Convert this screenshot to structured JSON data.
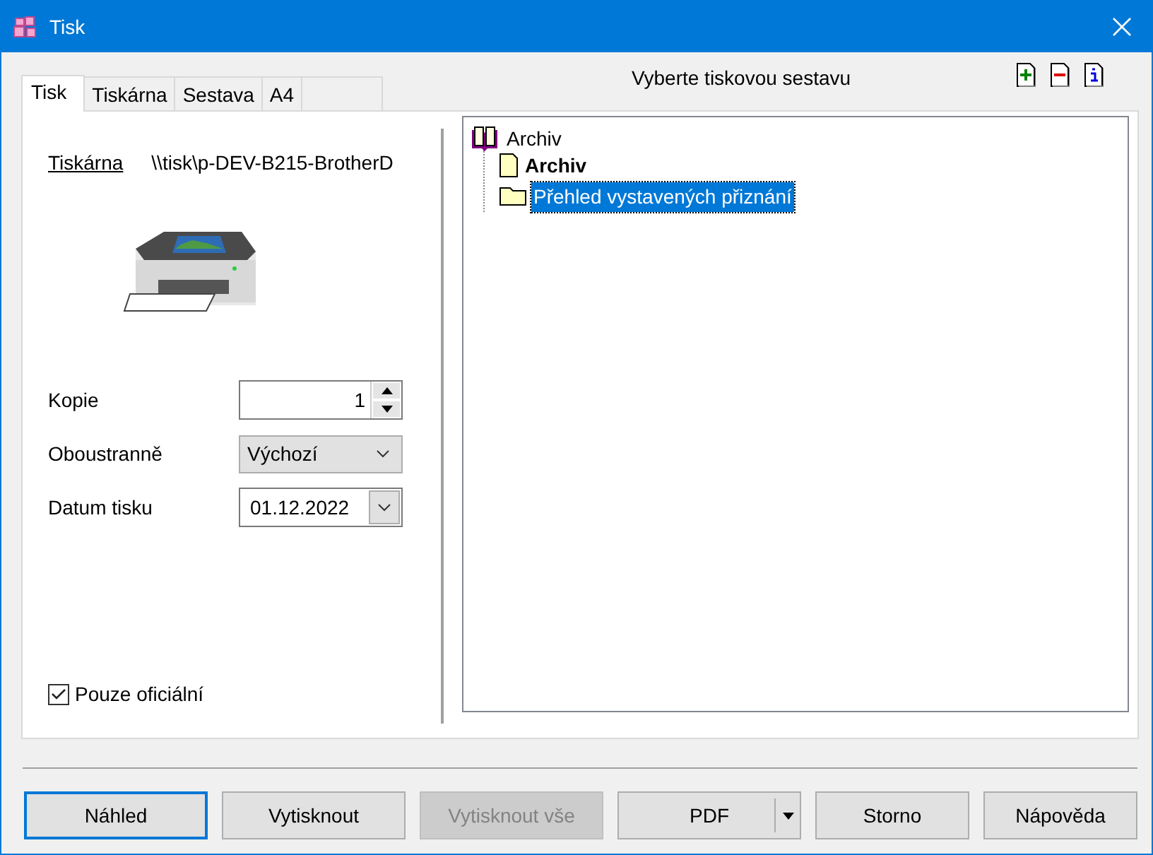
{
  "window": {
    "title": "Tisk"
  },
  "tabs": [
    {
      "label": "Tisk",
      "selected": true
    },
    {
      "label": "Tiskárna",
      "selected": false
    },
    {
      "label": "Sestava",
      "selected": false
    },
    {
      "label": "A4",
      "selected": false
    }
  ],
  "toolbar": [
    {
      "kind": "add"
    },
    {
      "kind": "remove"
    },
    {
      "kind": "info"
    }
  ],
  "printer": {
    "label": "Tiskárna",
    "value": "\\\\tisk\\p-DEV-B215-BrotherD"
  },
  "fields": [
    {
      "kind": "spin",
      "label": "Kopie",
      "value": "1"
    },
    {
      "kind": "select",
      "label": "Oboustranně",
      "value": "Výchozí"
    },
    {
      "kind": "date",
      "label": "Datum tisku",
      "value": "01.12.2022"
    }
  ],
  "official": {
    "label": "Pouze oficiální",
    "checked": true
  },
  "report_panel": {
    "title": "Vyberte tiskovou sestavu",
    "tree": [
      {
        "label": "Archiv",
        "kind": "book",
        "bold": false,
        "selected": false,
        "children": [
          {
            "label": "Archiv",
            "kind": "report",
            "bold": true,
            "selected": false
          },
          {
            "label": "Přehled vystavených přiznání",
            "kind": "folder",
            "bold": false,
            "selected": true
          }
        ]
      }
    ]
  },
  "buttons": [
    {
      "label": "Náhled",
      "kind": "plain",
      "focused": true,
      "disabled": false
    },
    {
      "label": "Vytisknout",
      "kind": "plain",
      "focused": false,
      "disabled": false
    },
    {
      "label": "Vytisknout vše",
      "kind": "plain",
      "focused": false,
      "disabled": true
    },
    {
      "label": "PDF",
      "kind": "split",
      "focused": false,
      "disabled": false
    },
    {
      "label": "Storno",
      "kind": "plain",
      "focused": false,
      "disabled": false
    },
    {
      "label": "Nápověda",
      "kind": "plain",
      "focused": false,
      "disabled": false
    }
  ]
}
